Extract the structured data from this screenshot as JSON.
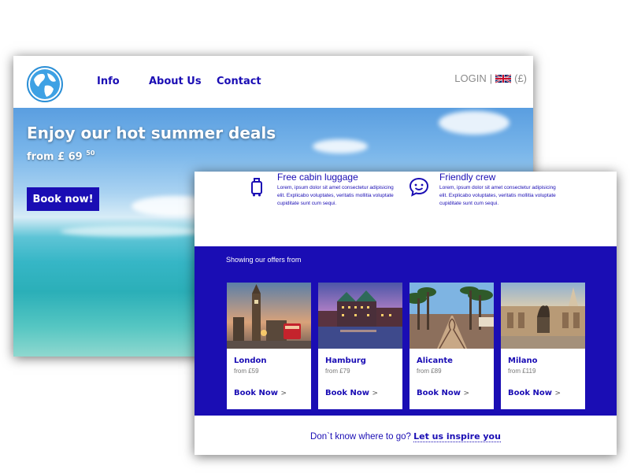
{
  "site": {
    "nav": {
      "info": "Info",
      "about": "About Us",
      "contact": "Contact"
    },
    "login": {
      "label": "LOGIN",
      "separator": "|",
      "currency": "(£)",
      "flag_icon": "uk-flag-icon"
    },
    "logo_icon": "globe-icon"
  },
  "hero": {
    "title": "Enjoy our hot summer deals",
    "price_prefix": "from £ 69",
    "price_cents": "50",
    "button": "Book now!"
  },
  "features": [
    {
      "icon": "luggage-icon",
      "title": "Free cabin luggage",
      "text": "Lorem, ipsum dolor sit amet consectetur adipisicing elit. Explicabo voluptates, veritatis mollitia voluptate cupiditate sunt cum sequi."
    },
    {
      "icon": "smile-chat-icon",
      "title": "Friendly crew",
      "text": "Lorem, ipsum dolor sit amet consectetur adipisicing elit. Explicabo voluptates, veritatis mollitia voluptate cupiditate sunt cum sequi."
    }
  ],
  "offers": {
    "heading": "Showing our offers from",
    "cards": [
      {
        "city": "London",
        "price": "from £59",
        "cta": "Book Now",
        "chevron": ">"
      },
      {
        "city": "Hamburg",
        "price": "from £79",
        "cta": "Book Now",
        "chevron": ">"
      },
      {
        "city": "Alicante",
        "price": "from £89",
        "cta": "Book Now",
        "chevron": ">"
      },
      {
        "city": "Milano",
        "price": "from £119",
        "cta": "Book Now",
        "chevron": ">"
      }
    ]
  },
  "inspire": {
    "question": "Don`t know where to go?",
    "link": "Let us inspire you"
  },
  "colors": {
    "brand": "#1a0db4",
    "muted": "#8a8a8a",
    "white": "#ffffff"
  }
}
